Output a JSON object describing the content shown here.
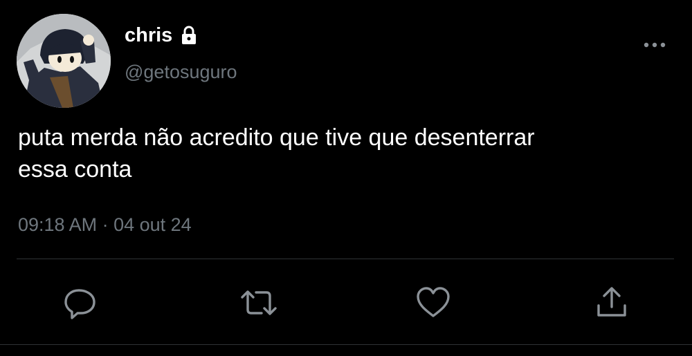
{
  "user": {
    "display_name": "chris",
    "handle": "@getosuguro",
    "avatar_icon": "anime-character-avatar",
    "protected_icon": "lock-icon"
  },
  "tweet": {
    "text": "puta merda não acredito que tive que desenterrar\nessa conta",
    "timestamp": "09:18 AM · 04 out 24"
  },
  "actions": {
    "reply_icon": "reply-icon",
    "retweet_icon": "retweet-icon",
    "like_icon": "heart-icon",
    "share_icon": "share-icon",
    "more_icon": "more-icon"
  },
  "colors": {
    "background": "#000000",
    "text": "#ffffff",
    "secondary": "#6e767d",
    "divider": "#2f3336"
  }
}
